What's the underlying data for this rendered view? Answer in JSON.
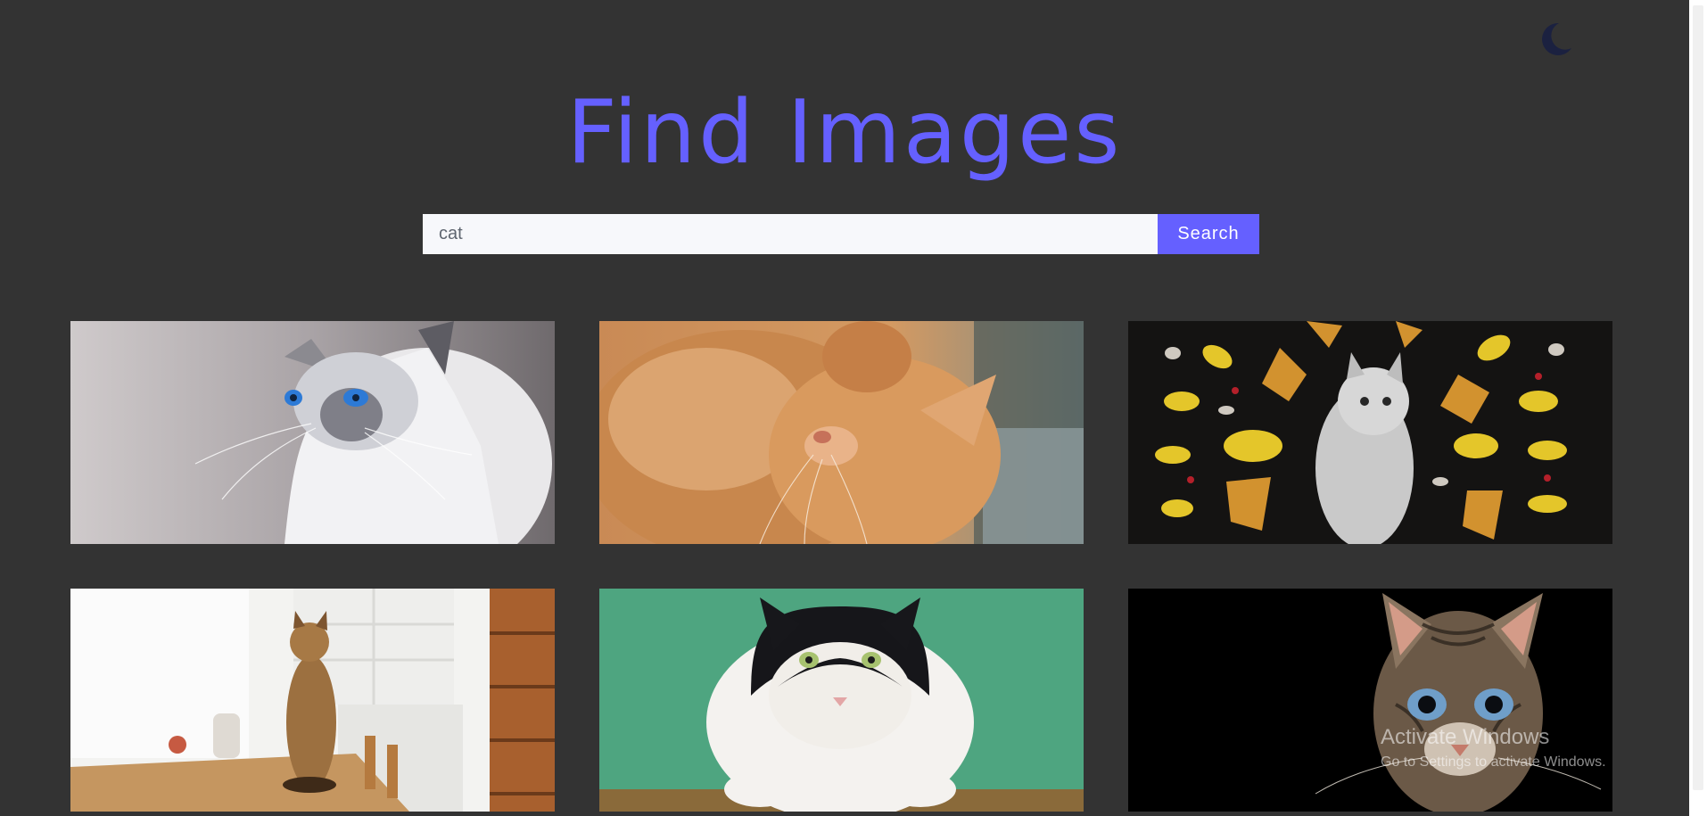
{
  "app": {
    "title": "Find Images",
    "theme_toggle_icon": "moon-icon"
  },
  "search": {
    "value": "cat",
    "placeholder": "",
    "button_label": "Search"
  },
  "results": [
    {
      "subject": "siamese-cat-looking-up"
    },
    {
      "subject": "ginger-cat-sleeping"
    },
    {
      "subject": "kitten-among-autumn-leaves"
    },
    {
      "subject": "tabby-cat-on-kitchen-table"
    },
    {
      "subject": "black-and-white-cat-green-wall"
    },
    {
      "subject": "tabby-cat-face-dark-background"
    }
  ],
  "overlay": {
    "title": "Activate Windows",
    "subtitle": "Go to Settings to activate Windows."
  },
  "colors": {
    "background": "#333333",
    "accent": "#6560ff",
    "input_background": "#f7f8fb",
    "moon": "#1b2140"
  }
}
